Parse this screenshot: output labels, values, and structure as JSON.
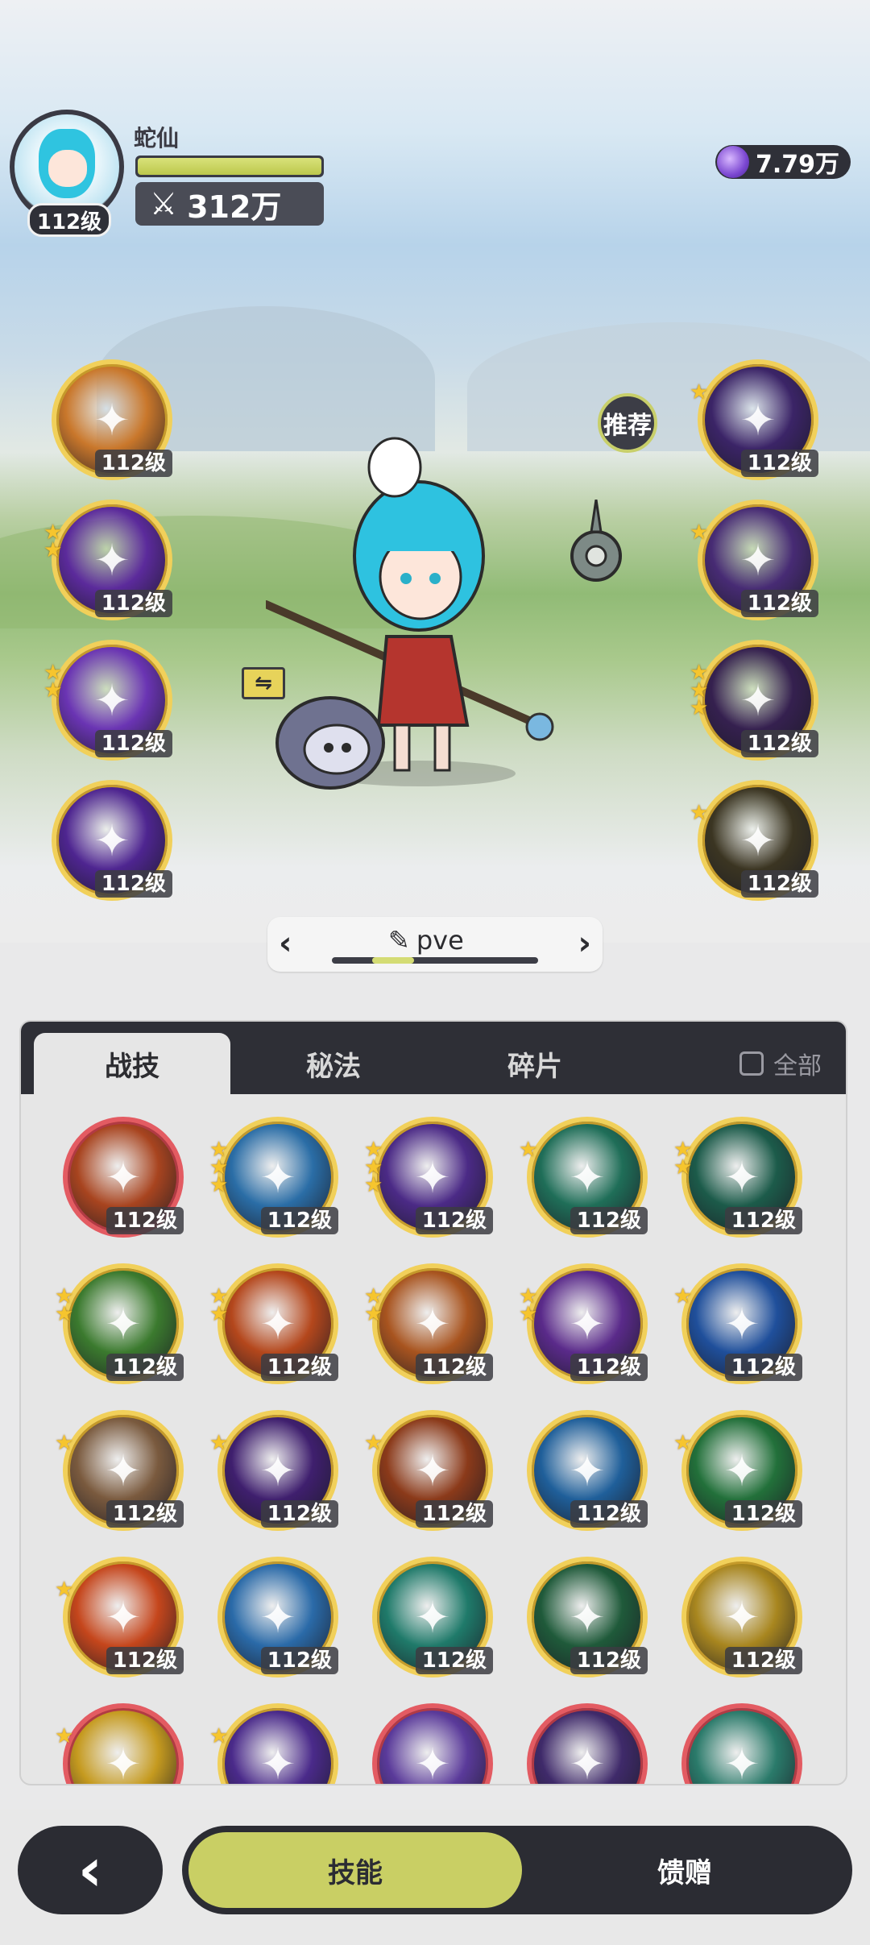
{
  "player": {
    "name": "蛇仙",
    "level": "112级",
    "power": "312万",
    "hp_fraction": 1.0,
    "currency": "7.79万"
  },
  "recommend_label": "推荐",
  "preset": {
    "name": "pve",
    "selected_index_fraction": 0.2
  },
  "equipped_left": [
    {
      "level": "112级",
      "stars": "",
      "color": "#c9772b",
      "icon": "tower-icon"
    },
    {
      "level": "112级",
      "stars": "★★",
      "color": "#5b2a9b",
      "icon": "claw-icon"
    },
    {
      "level": "112级",
      "stars": "★★",
      "color": "#6a34b3",
      "icon": "burst-icon"
    },
    {
      "level": "112级",
      "stars": "",
      "color": "#4e2590",
      "icon": "vortex-icon"
    }
  ],
  "equipped_right": [
    {
      "level": "112级",
      "stars": "★",
      "color": "#3b2467",
      "icon": "eye-rune-icon"
    },
    {
      "level": "112级",
      "stars": "★",
      "color": "#472b74",
      "icon": "hand-rune-icon"
    },
    {
      "level": "112级",
      "stars": "★★★",
      "color": "#35204f",
      "icon": "heart-rune-icon"
    },
    {
      "level": "112级",
      "stars": "★",
      "color": "#3b3522",
      "icon": "arrow-up-icon"
    }
  ],
  "tabs": [
    "战技",
    "秘法",
    "碎片"
  ],
  "all_label": "全部",
  "grid_skills": [
    {
      "level": "112级",
      "stars": "",
      "color": "#a8441f",
      "icon": "house-icon",
      "frame": "red"
    },
    {
      "level": "112级",
      "stars": "★★★",
      "color": "#2a6da6",
      "icon": "dragon-icon",
      "frame": "gold"
    },
    {
      "level": "112级",
      "stars": "★★★",
      "color": "#4b2a86",
      "icon": "star-icon",
      "frame": "gold"
    },
    {
      "level": "112级",
      "stars": "★",
      "color": "#1f6e58",
      "icon": "wind-icon",
      "frame": "gold"
    },
    {
      "level": "112级",
      "stars": "★★",
      "color": "#1c5b4a",
      "icon": "thorn-icon",
      "frame": "gold"
    },
    {
      "level": "112级",
      "stars": "★★",
      "color": "#3b7a2e",
      "icon": "banner-icon",
      "frame": "gold"
    },
    {
      "level": "112级",
      "stars": "★★",
      "color": "#b4471c",
      "icon": "fire-icon",
      "frame": "gold"
    },
    {
      "level": "112级",
      "stars": "★★",
      "color": "#a8541f",
      "icon": "phoenix-icon",
      "frame": "gold"
    },
    {
      "level": "112级",
      "stars": "★★",
      "color": "#5a2a8a",
      "icon": "diamond-icon",
      "frame": "gold"
    },
    {
      "level": "112级",
      "stars": "★",
      "color": "#1f4f9b",
      "icon": "water-icon",
      "frame": "gold"
    },
    {
      "level": "112级",
      "stars": "★",
      "color": "#7a5a3e",
      "icon": "cards-icon",
      "frame": "gold"
    },
    {
      "level": "112级",
      "stars": "★",
      "color": "#3f1f6e",
      "icon": "eye-icon",
      "frame": "gold"
    },
    {
      "level": "112级",
      "stars": "★",
      "color": "#8b3a1a",
      "icon": "flame-swirl-icon",
      "frame": "gold"
    },
    {
      "level": "112级",
      "stars": "",
      "color": "#1f5f9a",
      "icon": "crystal-icon",
      "frame": "gold"
    },
    {
      "level": "112级",
      "stars": "★",
      "color": "#22703a",
      "icon": "leaf-icon",
      "frame": "gold"
    },
    {
      "level": "112级",
      "stars": "★",
      "color": "#c5461c",
      "icon": "fireball-icon",
      "frame": "gold"
    },
    {
      "level": "112级",
      "stars": "",
      "color": "#2a6aa8",
      "icon": "ice-icon",
      "frame": "gold"
    },
    {
      "level": "112级",
      "stars": "",
      "color": "#1f7a6a",
      "icon": "swirl-icon",
      "frame": "gold"
    },
    {
      "level": "112级",
      "stars": "",
      "color": "#1f5a3a",
      "icon": "cross-heal-icon",
      "frame": "gold"
    },
    {
      "level": "112级",
      "stars": "",
      "color": "#a8861f",
      "icon": "sparkle-heal-icon",
      "frame": "gold"
    },
    {
      "level": "",
      "stars": "★",
      "color": "#c59a1f",
      "icon": "triangle-icon",
      "frame": "red"
    },
    {
      "level": "",
      "stars": "★",
      "color": "#4a2a8a",
      "icon": "ring-icon",
      "frame": "gold"
    },
    {
      "level": "",
      "stars": "",
      "color": "#5a3a9a",
      "icon": "wing-icon",
      "frame": "red"
    },
    {
      "level": "",
      "stars": "",
      "color": "#3f2a6a",
      "icon": "shield-icon",
      "frame": "red"
    },
    {
      "level": "",
      "stars": "",
      "color": "#2a7a6a",
      "icon": "orb-icon",
      "frame": "red"
    }
  ],
  "bottom_nav": {
    "back_glyph": "‹",
    "skill_label": "技能",
    "gift_label": "馈赠"
  },
  "glyphs": {
    "prev": "‹",
    "next": "›",
    "edit": "✎",
    "swap": "⇋",
    "power": "⚔"
  }
}
